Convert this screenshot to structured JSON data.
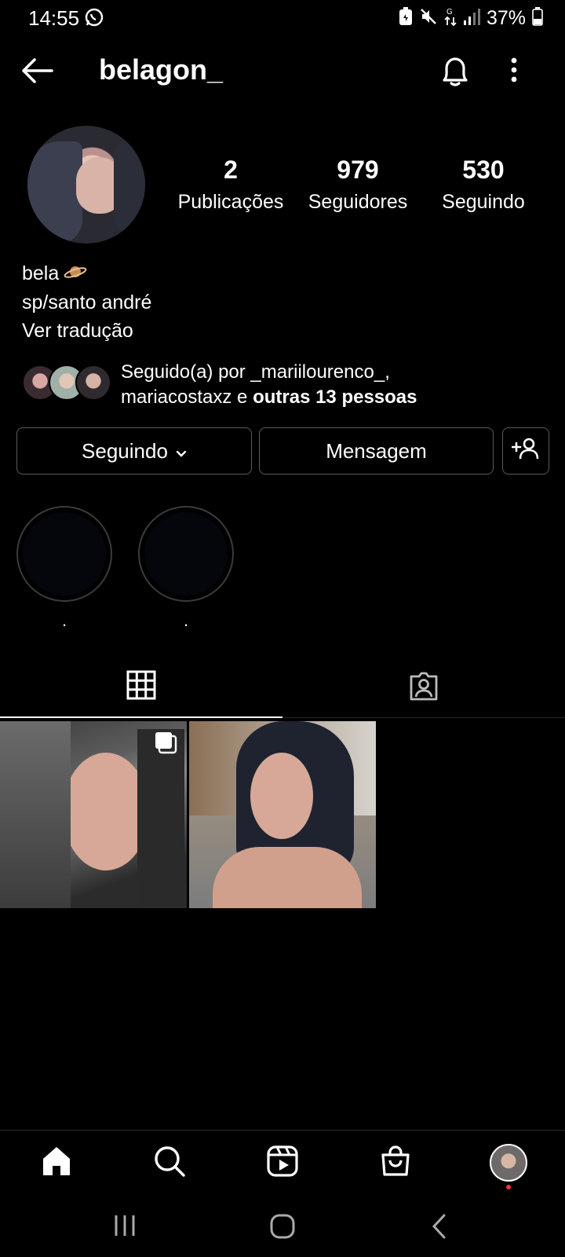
{
  "status_bar": {
    "time": "14:55",
    "battery": "37%"
  },
  "header": {
    "username": "belagon_"
  },
  "profile": {
    "stats": [
      {
        "value": "2",
        "label": "Publicações"
      },
      {
        "value": "979",
        "label": "Seguidores"
      },
      {
        "value": "530",
        "label": "Seguindo"
      }
    ],
    "bio": {
      "name": "bela",
      "location": "sp/santo andré",
      "translate": "Ver tradução"
    },
    "followed_by": {
      "prefix": "Seguido(a) por _mariilourenco_,",
      "line2_start": "mariacostaxz e ",
      "line2_bold": "outras 13 pessoas"
    }
  },
  "actions": {
    "following_label": "Seguindo",
    "message_label": "Mensagem"
  },
  "highlights": [
    {
      "caption": "."
    },
    {
      "caption": "."
    }
  ],
  "tabs": [
    "grid",
    "tagged"
  ],
  "posts": [
    {
      "multi": true
    },
    {
      "multi": false
    }
  ],
  "colors": {
    "background": "#000000",
    "text": "#ffffff",
    "border": "#5a5a5a",
    "notification_dot": "#ff3040"
  }
}
